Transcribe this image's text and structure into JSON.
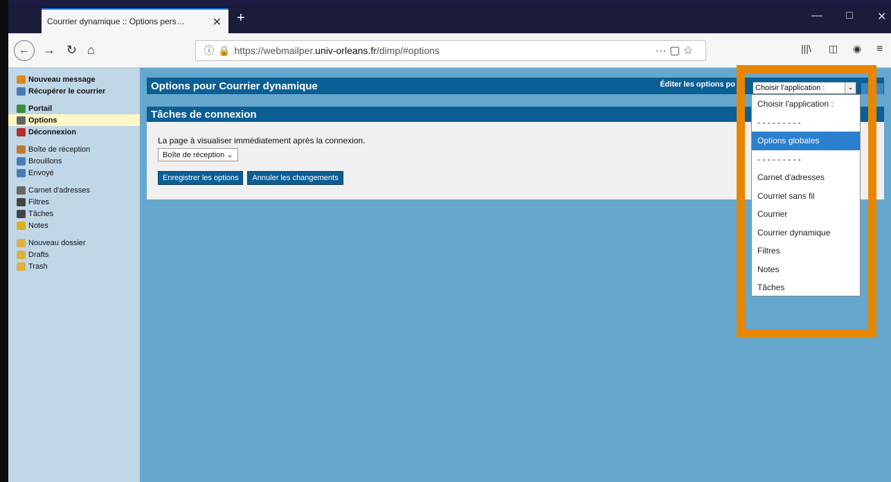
{
  "browser": {
    "tab_title": "Courrier dynamique :: Options pers…",
    "tab_close": "✕",
    "new_tab": "+",
    "url_prefix": "https://webmailper.",
    "url_domain": "univ-orleans.fr",
    "url_path": "/dimp/#options",
    "window_min": "—",
    "window_max": "□",
    "window_close": "✕"
  },
  "sidebar": {
    "top_items": [
      {
        "label": "Nouveau message",
        "icon": "compose-icon",
        "color": "#d88a20"
      },
      {
        "label": "Récupérer le courrier",
        "icon": "fetch-mail-icon",
        "color": "#4a7bb7"
      }
    ],
    "nav_items": [
      {
        "label": "Portail",
        "icon": "portal-icon",
        "color": "#3a8f3a"
      },
      {
        "label": "Options",
        "icon": "options-icon",
        "color": "#666666"
      },
      {
        "label": "Déconnexion",
        "icon": "logout-icon",
        "color": "#b03030"
      }
    ],
    "mail_items": [
      {
        "label": "Boîte de réception",
        "icon": "inbox-icon",
        "color": "#c07a30"
      },
      {
        "label": "Brouillons",
        "icon": "drafts-icon",
        "color": "#4a7bb7"
      },
      {
        "label": "Envoyé",
        "icon": "sent-icon",
        "color": "#4a7bb7"
      }
    ],
    "app_items": [
      {
        "label": "Carnet d'adresses",
        "icon": "addressbook-icon",
        "color": "#666666"
      },
      {
        "label": "Filtres",
        "icon": "filter-icon",
        "color": "#444444"
      },
      {
        "label": "Tâches",
        "icon": "tasks-icon",
        "color": "#444444"
      },
      {
        "label": "Notes",
        "icon": "notes-icon",
        "color": "#d8b020"
      }
    ],
    "folder_items": [
      {
        "label": "Nouveau dossier",
        "icon": "new-folder-icon",
        "color": "#e0b040"
      },
      {
        "label": "Drafts",
        "icon": "folder-icon",
        "color": "#e0b040"
      },
      {
        "label": "Trash",
        "icon": "folder-icon",
        "color": "#e0b040"
      }
    ]
  },
  "header": {
    "title": "Options pour Courrier dynamique",
    "edit_label": "Éditer les options po",
    "select_value": "Choisir l'application :"
  },
  "section": {
    "title": "Tâches de connexion",
    "label": "La page à visualiser immédiatement après la connexion.",
    "select_value": "Boîte de réception",
    "save_button": "Enregistrer les options",
    "cancel_button": "Annuler les changements"
  },
  "dropdown": {
    "options": [
      "Choisir l'application :",
      "- - - - - - - - -",
      "Options globales",
      "- - - - - - - - -",
      "Carnet d'adresses",
      "Courriel sans fil",
      "Courrier",
      "Courrier dynamique",
      "Filtres",
      "Notes",
      "Tâches"
    ],
    "selected_index": 2
  },
  "colors": {
    "accent_blue": "#0b5f95",
    "sidebar_bg": "#c0d7e8",
    "content_bg": "#66a7cd",
    "highlight_orange": "#e98600"
  }
}
